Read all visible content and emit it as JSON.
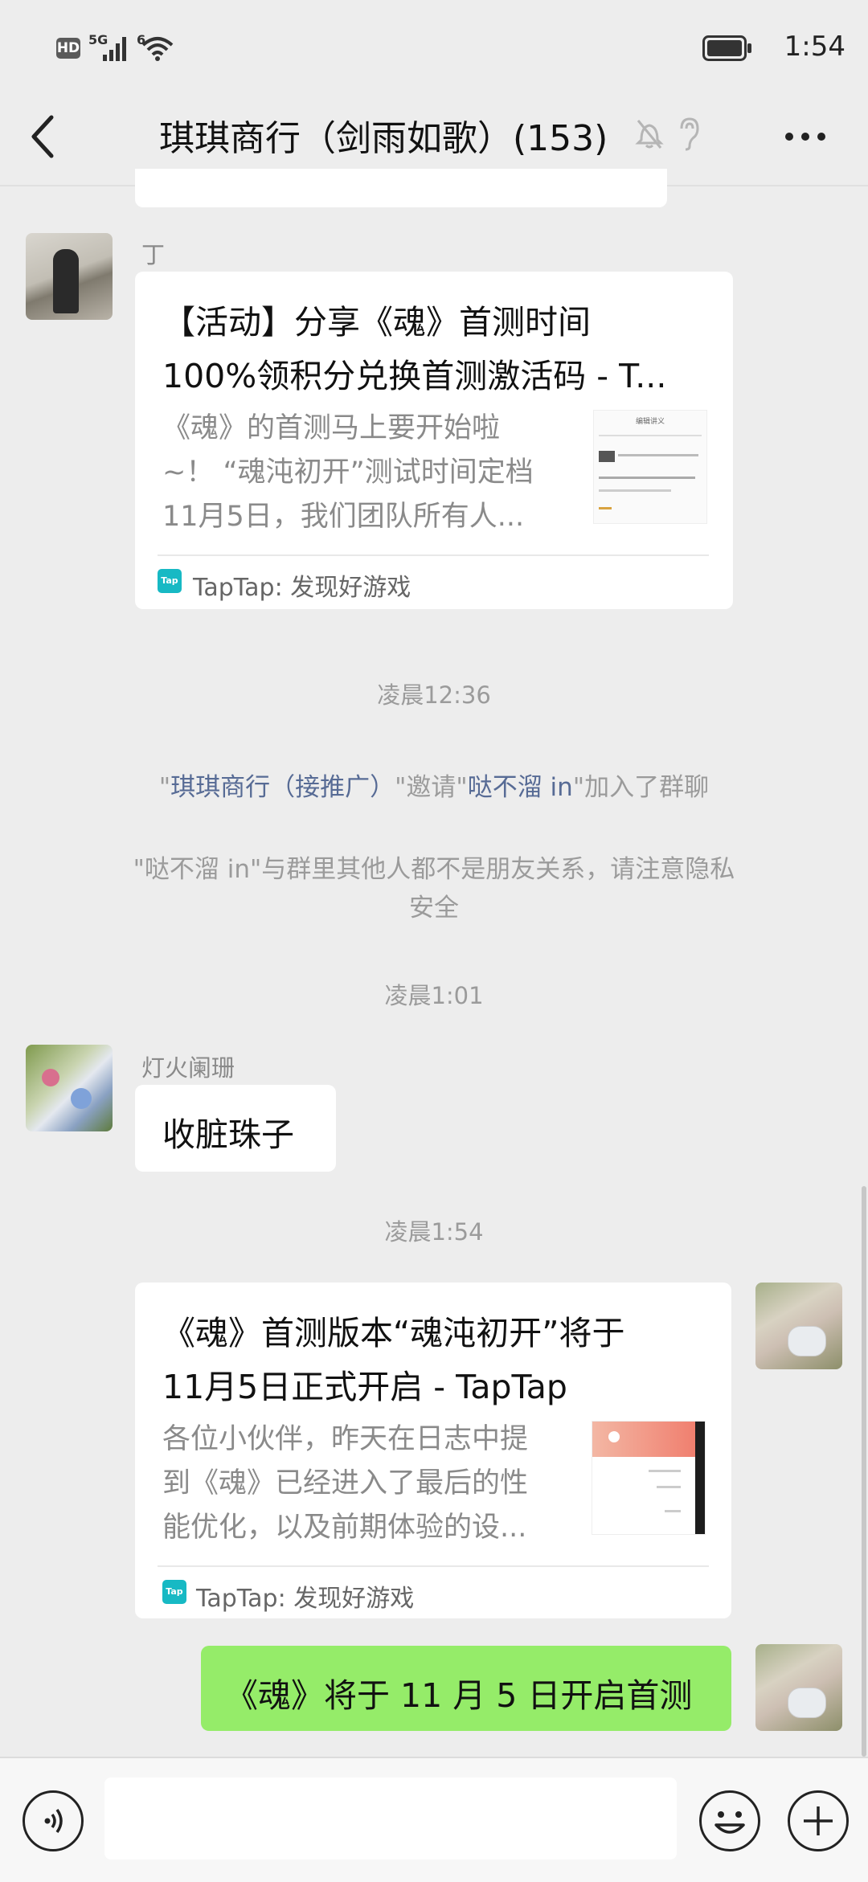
{
  "status_bar": {
    "hd": "HD",
    "network": "5G",
    "wifi_tag": "6",
    "time": "1:54"
  },
  "header": {
    "title": "琪琪商行（剑雨如歌）(153)",
    "back_icon": "chevron-left-icon",
    "mute_icon": "bell-off-icon",
    "ear_icon": "ear-icon",
    "more_icon": "more-dots-icon"
  },
  "messages": {
    "m1": {
      "sender": "丁",
      "card_title": "【活动】分享《魂》首测时间100%领积分兑换首测激活码 - T...",
      "card_title_line1": "【活动】分享《魂》首测时间",
      "card_title_line2": "100%领积分兑换首测激活码 - T...",
      "desc_line1": "《魂》的首测马上要开始啦",
      "desc_line2": "~！ “魂沌初开”测试时间定档",
      "desc_line3": "11月5日，我们团队所有人...",
      "thumb_heading": "编辑讲义",
      "source": "TapTap: 发现好游戏"
    },
    "time1": "凌晨12:36",
    "sys_invite": {
      "q1": "\"",
      "inviter": "琪琪商行（接推广）",
      "mid": "\"邀请\"",
      "invitee": "哒不溜 in",
      "tail": "\"加入了群聊"
    },
    "sys_privacy_line1": "\"哒不溜 in\"与群里其他人都不是朋友关系，请注意隐私",
    "sys_privacy_line2": "安全",
    "time2": "凌晨1:01",
    "m2": {
      "sender": "灯火阑珊",
      "text": "收脏珠子"
    },
    "time3": "凌晨1:54",
    "m3": {
      "card_title_line1": "《魂》首测版本“魂沌初开”将于",
      "card_title_line2": "11月5日正式开启 - TapTap",
      "desc_line1": "各位小伙伴，昨天在日志中提",
      "desc_line2": "到《魂》已经进入了最后的性",
      "desc_line3": "能优化，以及前期体验的设...",
      "source": "TapTap: 发现好游戏"
    },
    "m4": {
      "text": "《魂》将于 11 月 5 日开启首测"
    }
  },
  "input_bar": {
    "voice_icon": "voice-icon",
    "emoji_icon": "emoji-icon",
    "plus_icon": "plus-icon",
    "placeholder": ""
  },
  "colors": {
    "background": "#ededed",
    "sent_bubble": "#95ec69",
    "link": "#576b95"
  }
}
